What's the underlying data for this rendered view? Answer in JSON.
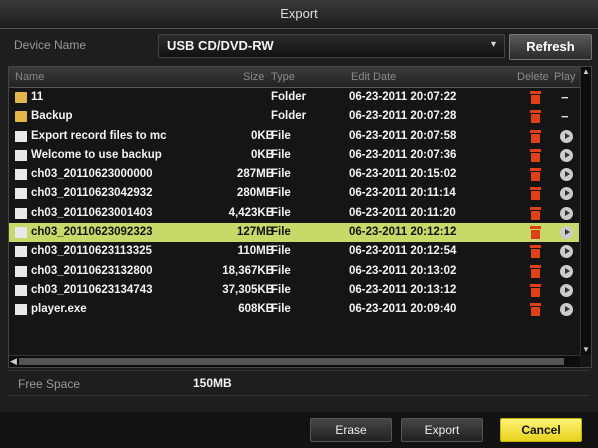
{
  "window": {
    "title": "Export"
  },
  "device": {
    "label": "Device Name",
    "value": "USB CD/DVD-RW",
    "refresh_label": "Refresh"
  },
  "table": {
    "headers": {
      "name": "Name",
      "size": "Size",
      "type": "Type",
      "edit_date": "Edit Date",
      "delete": "Delete",
      "play": "Play"
    },
    "rows": [
      {
        "kind": "folder",
        "name": "11",
        "size": "",
        "type": "Folder",
        "date": "06-23-2011 20:07:22",
        "action": "dash"
      },
      {
        "kind": "folder",
        "name": "Backup",
        "size": "",
        "type": "Folder",
        "date": "06-23-2011 20:07:28",
        "action": "dash"
      },
      {
        "kind": "file",
        "name": "Export record files to mc",
        "size": "0KB",
        "type": "File",
        "date": "06-23-2011 20:07:58",
        "action": "play"
      },
      {
        "kind": "file",
        "name": "Welcome to use backup",
        "size": "0KB",
        "type": "File",
        "date": "06-23-2011 20:07:36",
        "action": "play"
      },
      {
        "kind": "file",
        "name": "ch03_20110623000000",
        "size": "287MB",
        "type": "File",
        "date": "06-23-2011 20:15:02",
        "action": "play"
      },
      {
        "kind": "file",
        "name": "ch03_20110623042932",
        "size": "280MB",
        "type": "File",
        "date": "06-23-2011 20:11:14",
        "action": "play"
      },
      {
        "kind": "file",
        "name": "ch03_20110623001403",
        "size": "4,423KB",
        "type": "File",
        "date": "06-23-2011 20:11:20",
        "action": "play"
      },
      {
        "kind": "file",
        "name": "ch03_20110623092323",
        "size": "127MB",
        "type": "File",
        "date": "06-23-2011 20:12:12",
        "action": "play",
        "selected": true
      },
      {
        "kind": "file",
        "name": "ch03_20110623113325",
        "size": "110MB",
        "type": "File",
        "date": "06-23-2011 20:12:54",
        "action": "play"
      },
      {
        "kind": "file",
        "name": "ch03_20110623132800",
        "size": "18,367KB",
        "type": "File",
        "date": "06-23-2011 20:13:02",
        "action": "play"
      },
      {
        "kind": "file",
        "name": "ch03_20110623134743",
        "size": "37,305KB",
        "type": "File",
        "date": "06-23-2011 20:13:12",
        "action": "play"
      },
      {
        "kind": "file",
        "name": "player.exe",
        "size": "608KB",
        "type": "File",
        "date": "06-23-2011 20:09:40",
        "action": "play"
      }
    ]
  },
  "free_space": {
    "label": "Free Space",
    "value": "150MB"
  },
  "buttons": {
    "erase": "Erase",
    "export": "Export",
    "cancel": "Cancel"
  },
  "colors": {
    "selected_row": "#c8d96a",
    "cancel_button": "#f0df30",
    "delete_icon": "#e04018",
    "folder_icon": "#e2b64a"
  }
}
